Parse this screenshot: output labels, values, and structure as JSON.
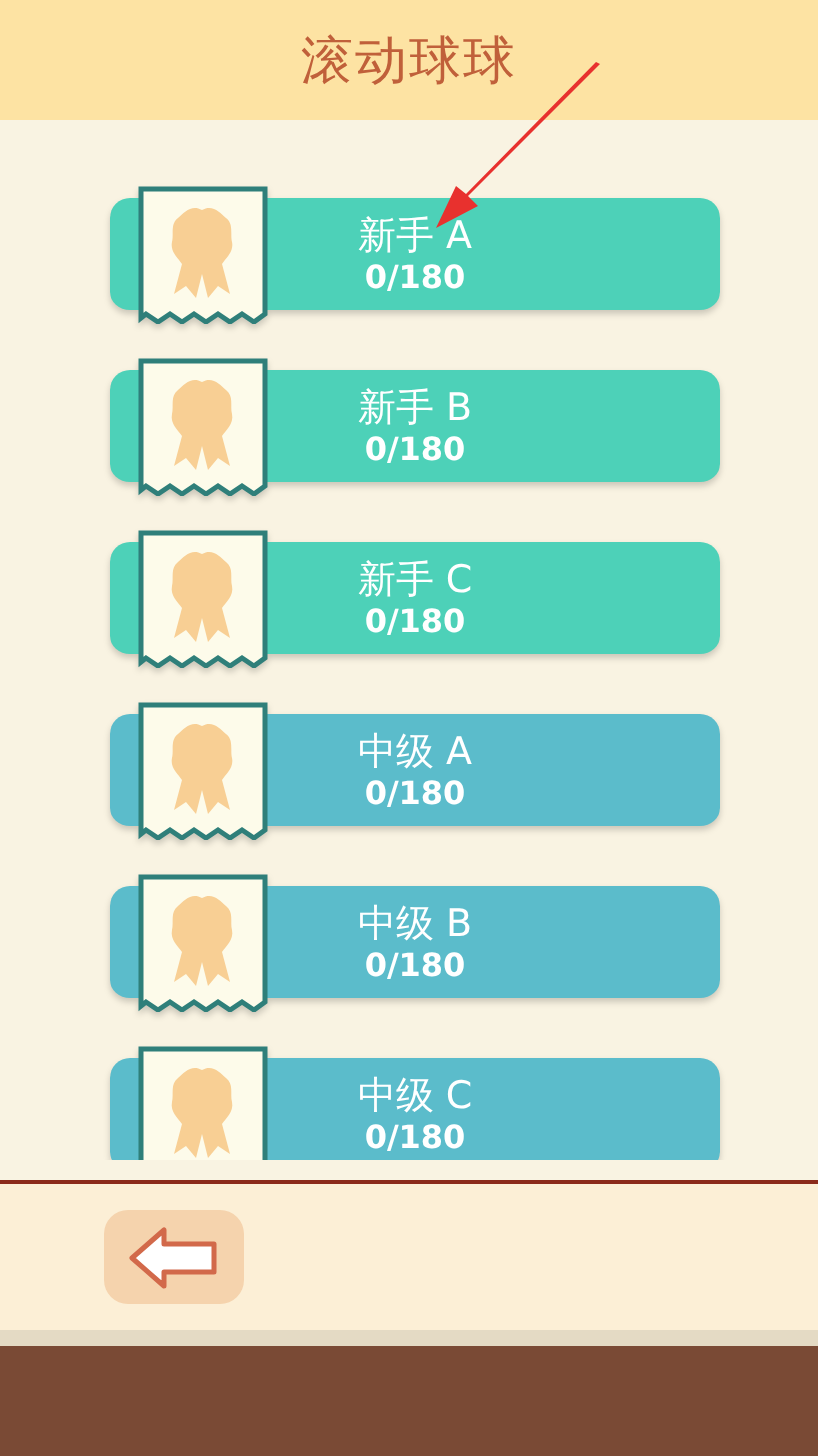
{
  "header": {
    "title": "滚动球球"
  },
  "levels": [
    {
      "name": "新手 A",
      "progress": "0/180",
      "color": "#4dd1b8"
    },
    {
      "name": "新手 B",
      "progress": "0/180",
      "color": "#4dd1b8"
    },
    {
      "name": "新手 C",
      "progress": "0/180",
      "color": "#4dd1b8"
    },
    {
      "name": "中级 A",
      "progress": "0/180",
      "color": "#5bbccb"
    },
    {
      "name": "中级 B",
      "progress": "0/180",
      "color": "#5bbccb"
    },
    {
      "name": "中级 C",
      "progress": "0/180",
      "color": "#5bbccb"
    }
  ]
}
